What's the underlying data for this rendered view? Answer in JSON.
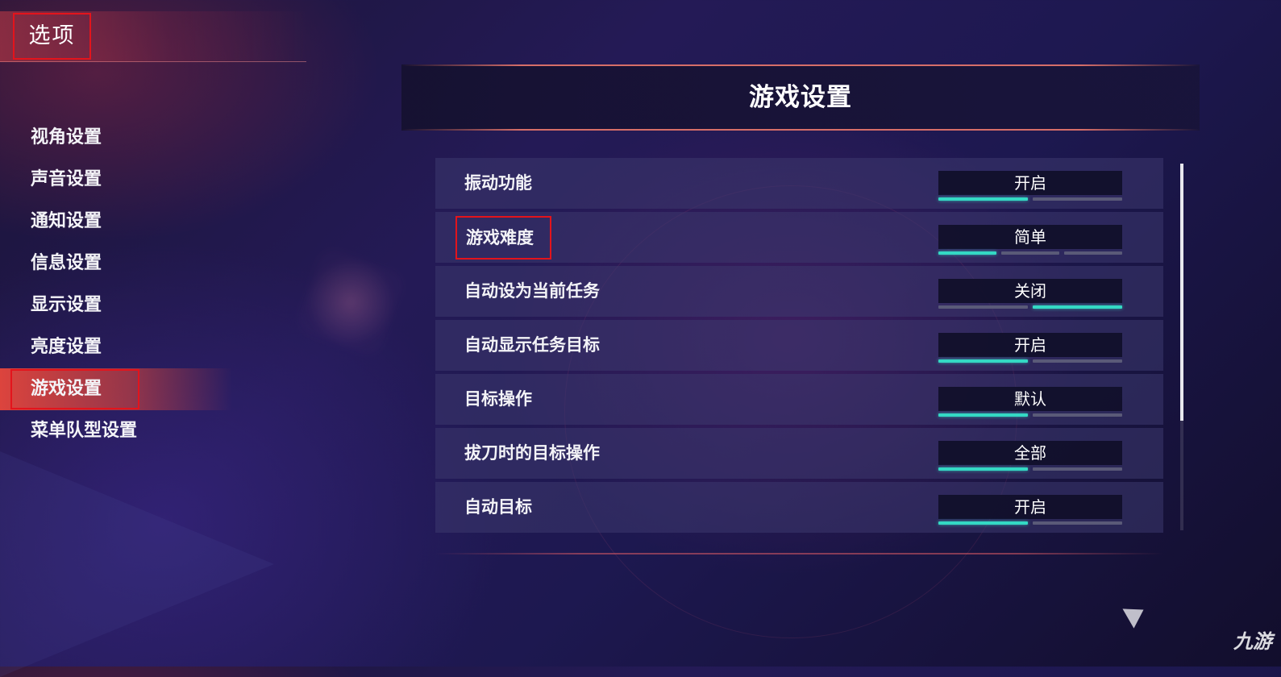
{
  "header": {
    "title": "选项"
  },
  "sidebar": {
    "items": [
      {
        "label": "视角设置",
        "active": false
      },
      {
        "label": "声音设置",
        "active": false
      },
      {
        "label": "通知设置",
        "active": false
      },
      {
        "label": "信息设置",
        "active": false
      },
      {
        "label": "显示设置",
        "active": false
      },
      {
        "label": "亮度设置",
        "active": false
      },
      {
        "label": "游戏设置",
        "active": true
      },
      {
        "label": "菜单队型设置",
        "active": false
      }
    ]
  },
  "panel": {
    "title": "游戏设置",
    "settings": [
      {
        "label": "振动功能",
        "value": "开启",
        "option_count": 2,
        "selected_index": 0
      },
      {
        "label": "游戏难度",
        "value": "简单",
        "option_count": 3,
        "selected_index": 0
      },
      {
        "label": "自动设为当前任务",
        "value": "关闭",
        "option_count": 2,
        "selected_index": 1
      },
      {
        "label": "自动显示任务目标",
        "value": "开启",
        "option_count": 2,
        "selected_index": 0
      },
      {
        "label": "目标操作",
        "value": "默认",
        "option_count": 2,
        "selected_index": 0
      },
      {
        "label": "拔刀时的目标操作",
        "value": "全部",
        "option_count": 2,
        "selected_index": 0
      },
      {
        "label": "自动目标",
        "value": "开启",
        "option_count": 2,
        "selected_index": 0
      }
    ],
    "scroll_fraction_visible": 0.7
  },
  "watermark": {
    "text": "九游",
    "icon": "9game-logo-icon"
  },
  "colors": {
    "accent_teal": "#34d9c4",
    "highlight_red": "#e3141c",
    "active_tab": "#e6463c"
  }
}
